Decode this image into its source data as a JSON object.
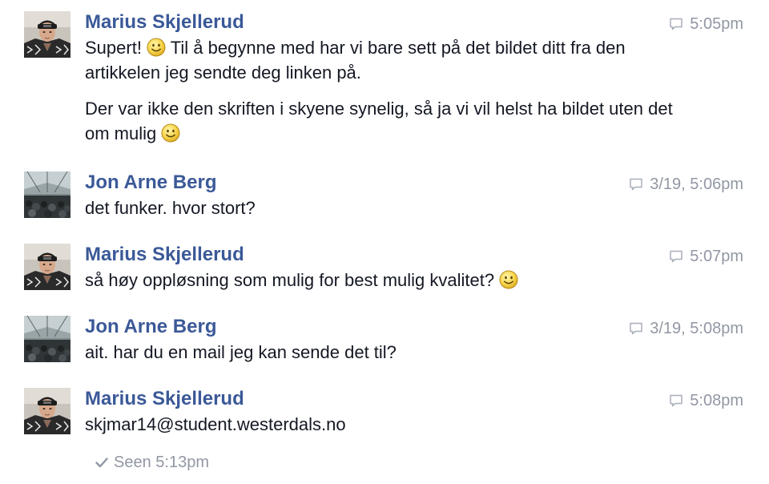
{
  "colors": {
    "sender": "#3b5998",
    "text": "#141823",
    "meta": "#9197a3"
  },
  "messages": [
    {
      "sender": "Marius Skjellerud",
      "timestamp": "5:05pm",
      "avatar": "marius-avatar",
      "p1_a": "Supert!",
      "p1_b": "Til å begynne med har vi bare sett på det bildet ditt fra den artikkelen jeg sendte deg linken på.",
      "p2_a": "Der var ikke den skriften i skyene synelig, så ja vi vil helst ha bildet uten det om mulig"
    },
    {
      "sender": "Jon Arne Berg",
      "timestamp": "3/19, 5:06pm",
      "avatar": "jon-avatar",
      "text": "det funker. hvor stort?"
    },
    {
      "sender": "Marius Skjellerud",
      "timestamp": "5:07pm",
      "avatar": "marius-avatar",
      "text": "så høy oppløsning som mulig for best mulig kvalitet?"
    },
    {
      "sender": "Jon Arne Berg",
      "timestamp": "3/19, 5:08pm",
      "avatar": "jon-avatar",
      "text": "ait. har du en mail jeg kan sende det til?"
    },
    {
      "sender": "Marius Skjellerud",
      "timestamp": "5:08pm",
      "avatar": "marius-avatar",
      "text": "skjmar14@student.westerdals.no"
    }
  ],
  "seen": {
    "text": "Seen 5:13pm",
    "icon": "checkmark-icon"
  },
  "icons": {
    "timestamp": "speech-bubble-icon",
    "emoji": "smiley-emoji"
  }
}
